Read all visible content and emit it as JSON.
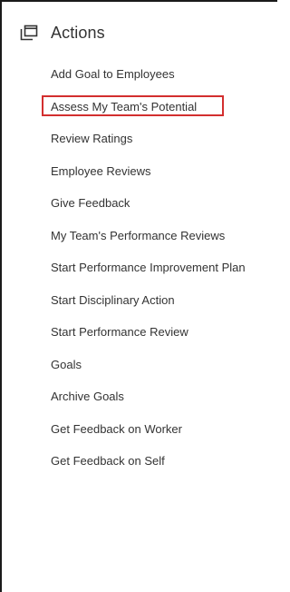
{
  "panel": {
    "title": "Actions",
    "icon": "actions-icon",
    "highlight_color": "#d32f2f",
    "highlighted_index": 1,
    "items": [
      {
        "label": "Add Goal to Employees"
      },
      {
        "label": "Assess My Team's Potential"
      },
      {
        "label": "Review Ratings"
      },
      {
        "label": "Employee Reviews"
      },
      {
        "label": "Give Feedback"
      },
      {
        "label": "My Team's Performance Reviews"
      },
      {
        "label": "Start Performance Improvement Plan"
      },
      {
        "label": "Start Disciplinary Action"
      },
      {
        "label": "Start Performance Review"
      },
      {
        "label": "Goals"
      },
      {
        "label": "Archive Goals"
      },
      {
        "label": "Get Feedback on Worker"
      },
      {
        "label": "Get Feedback on Self"
      }
    ]
  }
}
